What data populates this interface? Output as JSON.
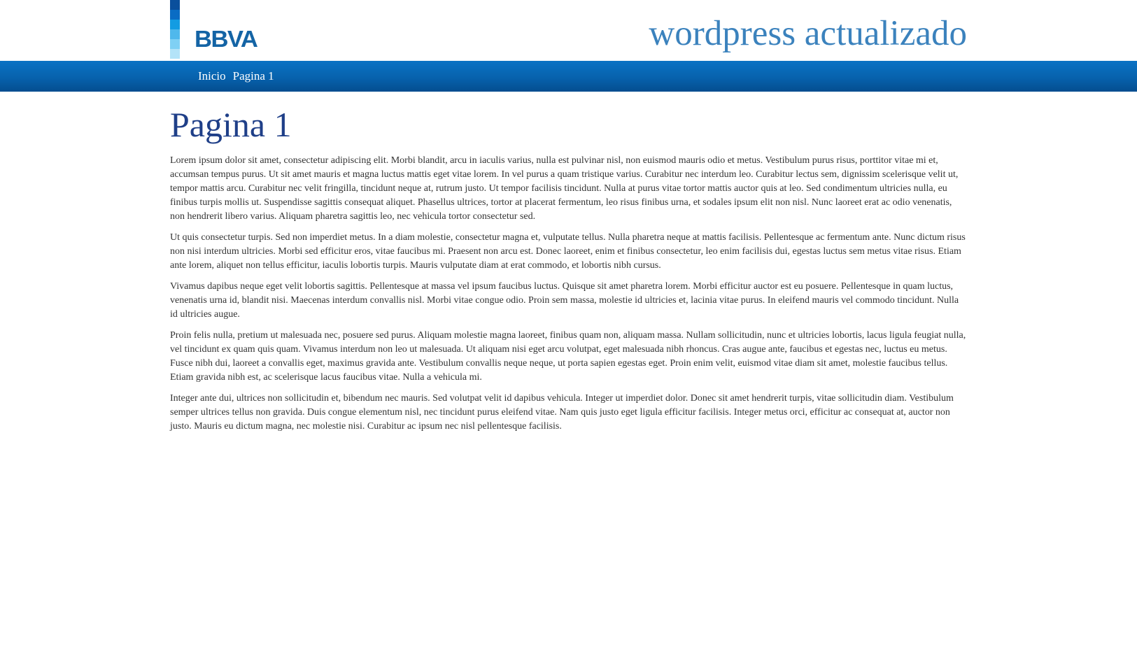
{
  "header": {
    "logo_text": "BBVA",
    "logo_colors": [
      "#0a4f9c",
      "#0a6cc4",
      "#139ce2",
      "#4fb8ec",
      "#7fd0f4",
      "#b3e3f8"
    ],
    "site_title": "wordpress actualizado"
  },
  "nav": {
    "items": [
      {
        "label": "Inicio"
      },
      {
        "label": "Pagina 1"
      }
    ]
  },
  "main": {
    "title": "Pagina 1",
    "paragraphs": [
      "Lorem ipsum dolor sit amet, consectetur adipiscing elit. Morbi blandit, arcu in iaculis varius, nulla est pulvinar nisl, non euismod mauris odio et metus. Vestibulum purus risus, porttitor vitae mi et, accumsan tempus purus. Ut sit amet mauris et magna luctus mattis eget vitae lorem. In vel purus a quam tristique varius. Curabitur nec interdum leo. Curabitur lectus sem, dignissim scelerisque velit ut, tempor mattis arcu. Curabitur nec velit fringilla, tincidunt neque at, rutrum justo. Ut tempor facilisis tincidunt. Nulla at purus vitae tortor mattis auctor quis at leo. Sed condimentum ultricies nulla, eu finibus turpis mollis ut. Suspendisse sagittis consequat aliquet. Phasellus ultrices, tortor at placerat fermentum, leo risus finibus urna, et sodales ipsum elit non nisl. Nunc laoreet erat ac odio venenatis, non hendrerit libero varius. Aliquam pharetra sagittis leo, nec vehicula tortor consectetur sed.",
      "Ut quis consectetur turpis. Sed non imperdiet metus. In a diam molestie, consectetur magna et, vulputate tellus. Nulla pharetra neque at mattis facilisis. Pellentesque ac fermentum ante. Nunc dictum risus non nisi interdum ultricies. Morbi sed efficitur eros, vitae faucibus mi. Praesent non arcu est. Donec laoreet, enim et finibus consectetur, leo enim facilisis dui, egestas luctus sem metus vitae risus. Etiam ante lorem, aliquet non tellus efficitur, iaculis lobortis turpis. Mauris vulputate diam at erat commodo, et lobortis nibh cursus.",
      "Vivamus dapibus neque eget velit lobortis sagittis. Pellentesque at massa vel ipsum faucibus luctus. Quisque sit amet pharetra lorem. Morbi efficitur auctor est eu posuere. Pellentesque in quam luctus, venenatis urna id, blandit nisi. Maecenas interdum convallis nisl. Morbi vitae congue odio. Proin sem massa, molestie id ultricies et, lacinia vitae purus. In eleifend mauris vel commodo tincidunt. Nulla id ultricies augue.",
      "Proin felis nulla, pretium ut malesuada nec, posuere sed purus. Aliquam molestie magna laoreet, finibus quam non, aliquam massa. Nullam sollicitudin, nunc et ultricies lobortis, lacus ligula feugiat nulla, vel tincidunt ex quam quis quam. Vivamus interdum non leo ut malesuada. Ut aliquam nisi eget arcu volutpat, eget malesuada nibh rhoncus. Cras augue ante, faucibus et egestas nec, luctus eu metus. Fusce nibh dui, laoreet a convallis eget, maximus gravida ante. Vestibulum convallis neque neque, ut porta sapien egestas eget. Proin enim velit, euismod vitae diam sit amet, molestie faucibus tellus. Etiam gravida nibh est, ac scelerisque lacus faucibus vitae. Nulla a vehicula mi.",
      "Integer ante dui, ultrices non sollicitudin et, bibendum nec mauris. Sed volutpat velit id dapibus vehicula. Integer ut imperdiet dolor. Donec sit amet hendrerit turpis, vitae sollicitudin diam. Vestibulum semper ultrices tellus non gravida. Duis congue elementum nisl, nec tincidunt purus eleifend vitae. Nam quis justo eget ligula efficitur facilisis. Integer metus orci, efficitur ac consequat at, auctor non justo. Mauris eu dictum magna, nec molestie nisi. Curabitur ac ipsum nec nisl pellentesque facilisis."
    ]
  }
}
